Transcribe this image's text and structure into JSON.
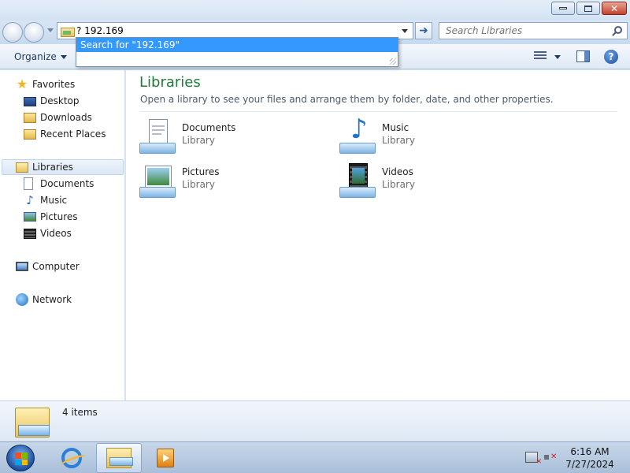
{
  "address": {
    "value": "? 192.169"
  },
  "suggestion": {
    "label": "Search for \"192.169\""
  },
  "search": {
    "placeholder": "Search Libraries"
  },
  "toolbar": {
    "organize_label": "Organize",
    "help_label": "?"
  },
  "sidebar": {
    "favorites": {
      "label": "Favorites",
      "items": [
        {
          "label": "Desktop"
        },
        {
          "label": "Downloads"
        },
        {
          "label": "Recent Places"
        }
      ]
    },
    "libraries": {
      "label": "Libraries",
      "items": [
        {
          "label": "Documents"
        },
        {
          "label": "Music"
        },
        {
          "label": "Pictures"
        },
        {
          "label": "Videos"
        }
      ]
    },
    "computer": {
      "label": "Computer"
    },
    "network": {
      "label": "Network"
    }
  },
  "main": {
    "title": "Libraries",
    "subtitle": "Open a library to see your files and arrange them by folder, date, and other properties.",
    "libraries": [
      {
        "name": "Documents",
        "type": "Library",
        "icon": "documents-library-icon"
      },
      {
        "name": "Music",
        "type": "Library",
        "icon": "music-library-icon"
      },
      {
        "name": "Pictures",
        "type": "Library",
        "icon": "pictures-library-icon"
      },
      {
        "name": "Videos",
        "type": "Library",
        "icon": "videos-library-icon"
      }
    ]
  },
  "details": {
    "count_text": "4 items"
  },
  "taskbar": {
    "apps": [
      "start-orb",
      "internet-explorer",
      "windows-explorer",
      "windows-media-player"
    ],
    "clock": {
      "time": "6:16 AM",
      "date": "7/27/2024"
    }
  }
}
